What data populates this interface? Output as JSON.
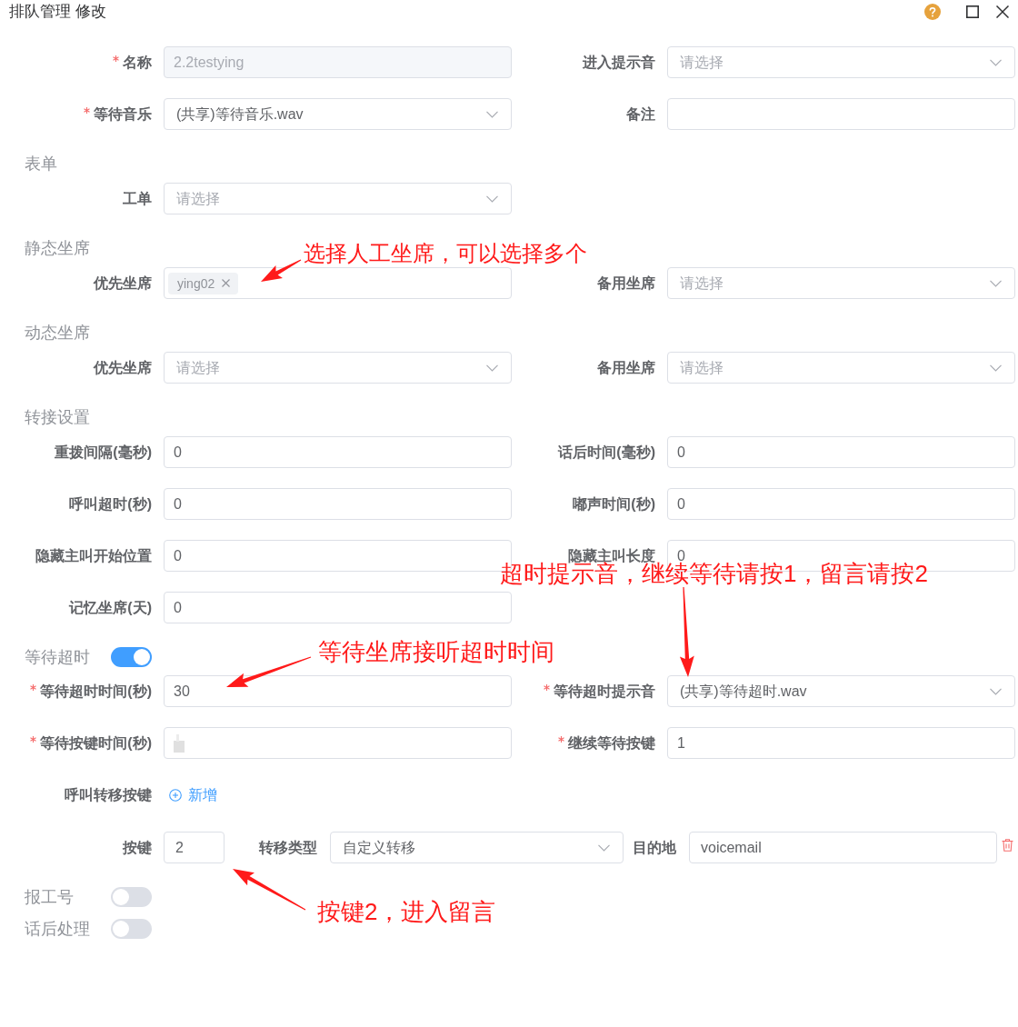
{
  "window": {
    "title": "排队管理 修改"
  },
  "form": [
    {
      "kind": "row",
      "fields": [
        {
          "label": "名称",
          "required": true,
          "kind": "input",
          "value": "2.2testying",
          "disabled": true
        },
        {
          "label": "进入提示音",
          "required": false,
          "kind": "select",
          "placeholder": "请选择"
        }
      ]
    },
    {
      "kind": "row",
      "fields": [
        {
          "label": "等待音乐",
          "required": true,
          "kind": "select",
          "value": "(共享)等待音乐.wav"
        },
        {
          "label": "备注",
          "required": false,
          "kind": "input"
        }
      ]
    },
    {
      "kind": "section",
      "title": "表单"
    },
    {
      "kind": "row",
      "fields": [
        {
          "label": "工单",
          "required": false,
          "kind": "select",
          "placeholder": "请选择"
        }
      ]
    },
    {
      "kind": "section",
      "title": "静态坐席"
    },
    {
      "kind": "row",
      "fields": [
        {
          "label": "优先坐席",
          "required": false,
          "kind": "tags",
          "tags": [
            {
              "label": "ying02"
            }
          ]
        },
        {
          "label": "备用坐席",
          "required": false,
          "kind": "select",
          "placeholder": "请选择"
        }
      ]
    },
    {
      "kind": "section",
      "title": "动态坐席"
    },
    {
      "kind": "row",
      "fields": [
        {
          "label": "优先坐席",
          "required": false,
          "kind": "select",
          "placeholder": "请选择"
        },
        {
          "label": "备用坐席",
          "required": false,
          "kind": "select",
          "placeholder": "请选择"
        }
      ]
    },
    {
      "kind": "section",
      "title": "转接设置"
    },
    {
      "kind": "row",
      "fields": [
        {
          "label": "重拨间隔(毫秒)",
          "required": false,
          "kind": "input",
          "value": "0"
        },
        {
          "label": "话后时间(毫秒)",
          "required": false,
          "kind": "input",
          "value": "0"
        }
      ]
    },
    {
      "kind": "row",
      "fields": [
        {
          "label": "呼叫超时(秒)",
          "required": false,
          "kind": "input",
          "value": "0"
        },
        {
          "label": "嘟声时间(秒)",
          "required": false,
          "kind": "input",
          "value": "0"
        }
      ]
    },
    {
      "kind": "row",
      "fields": [
        {
          "label": "隐藏主叫开始位置",
          "required": false,
          "kind": "input",
          "value": "0"
        },
        {
          "label": "隐藏主叫长度",
          "required": false,
          "kind": "input",
          "value": "0"
        }
      ]
    },
    {
      "kind": "row",
      "fields": [
        {
          "label": "记忆坐席(天)",
          "required": false,
          "kind": "input",
          "value": "0"
        }
      ]
    },
    {
      "kind": "switch",
      "label": "等待超时",
      "on": true
    },
    {
      "kind": "row",
      "fields": [
        {
          "label": "等待超时时间(秒)",
          "required": true,
          "kind": "input",
          "value": "30"
        },
        {
          "label": "等待超时提示音",
          "required": true,
          "kind": "select",
          "value": "(共享)等待超时.wav"
        }
      ]
    },
    {
      "kind": "row",
      "fields": [
        {
          "label": "等待按键时间(秒)",
          "required": true,
          "kind": "input",
          "value_hidden": true
        },
        {
          "label": "继续等待按键",
          "required": true,
          "kind": "input",
          "value": "1"
        }
      ]
    },
    {
      "kind": "add",
      "label": "呼叫转移按键",
      "action": "新增"
    },
    {
      "kind": "transfer",
      "key": {
        "label": "按键",
        "value": "2"
      },
      "type": {
        "label": "转移类型",
        "value": "自定义转移"
      },
      "destination": {
        "label": "目的地",
        "value": "voicemail"
      }
    },
    {
      "kind": "switch",
      "label": "报工号",
      "on": false
    },
    {
      "kind": "switch",
      "label": "话后处理",
      "on": false
    }
  ],
  "annotations": [
    {
      "text": "选择人工坐席，可以选择多个"
    },
    {
      "text": "超时提示音，继续等待请按1，留言请按2"
    },
    {
      "text": "等待坐席接听超时时间"
    },
    {
      "text": "按键2，进入留言"
    }
  ]
}
